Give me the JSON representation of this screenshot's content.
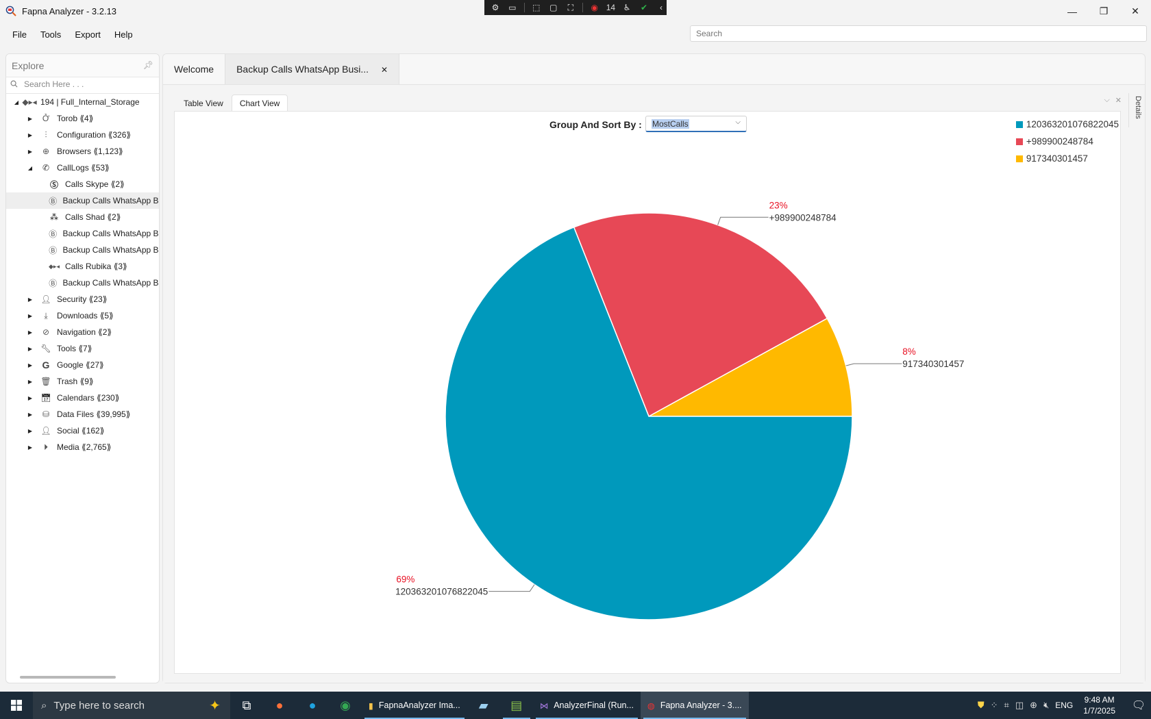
{
  "window": {
    "title": "Fapna Analyzer -  3.2.13",
    "controls": {
      "minimize": "—",
      "maximize": "❐",
      "close": "✕"
    }
  },
  "recording_toolbar": {
    "count_label": "14"
  },
  "menu": [
    "File",
    "Tools",
    "Export",
    "Help"
  ],
  "global_search": {
    "placeholder": "Search"
  },
  "explore": {
    "title": "Explore",
    "search_placeholder": "Search Here . . .",
    "root": {
      "label": "194 | Full_Internal_Storage",
      "icon": "storage-icon",
      "expanded": true
    },
    "items": [
      {
        "label": "Torob ⟪4⟫",
        "icon": "torob-icon",
        "expanded": false,
        "level": 1
      },
      {
        "label": "Configuration ⟪326⟫",
        "icon": "sliders-icon",
        "expanded": false,
        "level": 1
      },
      {
        "label": "Browsers ⟪1,123⟫",
        "icon": "globe-icon",
        "expanded": false,
        "level": 1
      },
      {
        "label": "CallLogs ⟪53⟫",
        "icon": "phone-icon",
        "expanded": true,
        "level": 1
      },
      {
        "label": "Calls Skype ⟪2⟫",
        "icon": "skype-icon",
        "level": 2
      },
      {
        "label": "Backup Calls WhatsApp Business",
        "icon": "whatsapp-business-icon",
        "level": 2,
        "selected": true
      },
      {
        "label": "Calls Shad ⟪2⟫",
        "icon": "shad-icon",
        "level": 2
      },
      {
        "label": "Backup Calls WhatsApp Business",
        "icon": "whatsapp-business-icon",
        "level": 2
      },
      {
        "label": "Backup Calls WhatsApp Business",
        "icon": "whatsapp-business-icon",
        "level": 2
      },
      {
        "label": "Calls Rubika ⟪3⟫",
        "icon": "rubika-icon",
        "level": 2
      },
      {
        "label": "Backup Calls WhatsApp Business",
        "icon": "whatsapp-business-icon",
        "level": 2
      },
      {
        "label": "Security ⟪23⟫",
        "icon": "security-icon",
        "expanded": false,
        "level": 1
      },
      {
        "label": "Downloads ⟪5⟫",
        "icon": "download-icon",
        "expanded": false,
        "level": 1
      },
      {
        "label": "Navigation ⟪2⟫",
        "icon": "compass-icon",
        "expanded": false,
        "level": 1
      },
      {
        "label": "Tools ⟪7⟫",
        "icon": "wrench-icon",
        "expanded": false,
        "level": 1
      },
      {
        "label": "Google ⟪27⟫",
        "icon": "google-icon",
        "expanded": false,
        "level": 1
      },
      {
        "label": "Trash ⟪9⟫",
        "icon": "trash-icon",
        "expanded": false,
        "level": 1
      },
      {
        "label": "Calendars ⟪230⟫",
        "icon": "calendar-icon",
        "expanded": false,
        "level": 1
      },
      {
        "label": "Data Files ⟪39,995⟫",
        "icon": "database-icon",
        "expanded": false,
        "level": 1
      },
      {
        "label": "Social ⟪162⟫",
        "icon": "social-icon",
        "expanded": false,
        "level": 1
      },
      {
        "label": "Media ⟪2,765⟫",
        "icon": "media-icon",
        "expanded": false,
        "level": 1
      }
    ]
  },
  "doc_tabs": [
    {
      "label": "Welcome",
      "active": false
    },
    {
      "label": "Backup Calls WhatsApp Busi...",
      "active": true,
      "closable": true,
      "close_label": "✕"
    }
  ],
  "view_tabs": [
    {
      "label": "Table View",
      "active": false
    },
    {
      "label": "Chart View",
      "active": true
    }
  ],
  "details_label": "Details",
  "group_sort": {
    "label": "Group And Sort By :",
    "value": "MostCalls"
  },
  "chart_data": {
    "type": "pie",
    "title": "",
    "slices": [
      {
        "label": "120363201076822045",
        "percent": 69,
        "color": "#0099bc"
      },
      {
        "label": "+989900248784",
        "percent": 23,
        "color": "#e74856"
      },
      {
        "label": "917340301457",
        "percent": 8,
        "color": "#ffb900"
      }
    ],
    "percent_label_color": "#e81123",
    "legend_placement": "top-right"
  },
  "taskbar": {
    "search_placeholder": "Type here to search",
    "apps": [
      {
        "label": "FapnaAnalyzer Ima...",
        "icon": "folder-icon",
        "active": false
      },
      {
        "label": "AnalyzerFinal (Run...",
        "icon": "visual-studio-icon",
        "active": false
      },
      {
        "label": "Fapna Analyzer - 3....",
        "icon": "fapna-icon",
        "active": true
      }
    ],
    "language": "ENG",
    "time": "9:48 AM",
    "date": "1/7/2025"
  }
}
